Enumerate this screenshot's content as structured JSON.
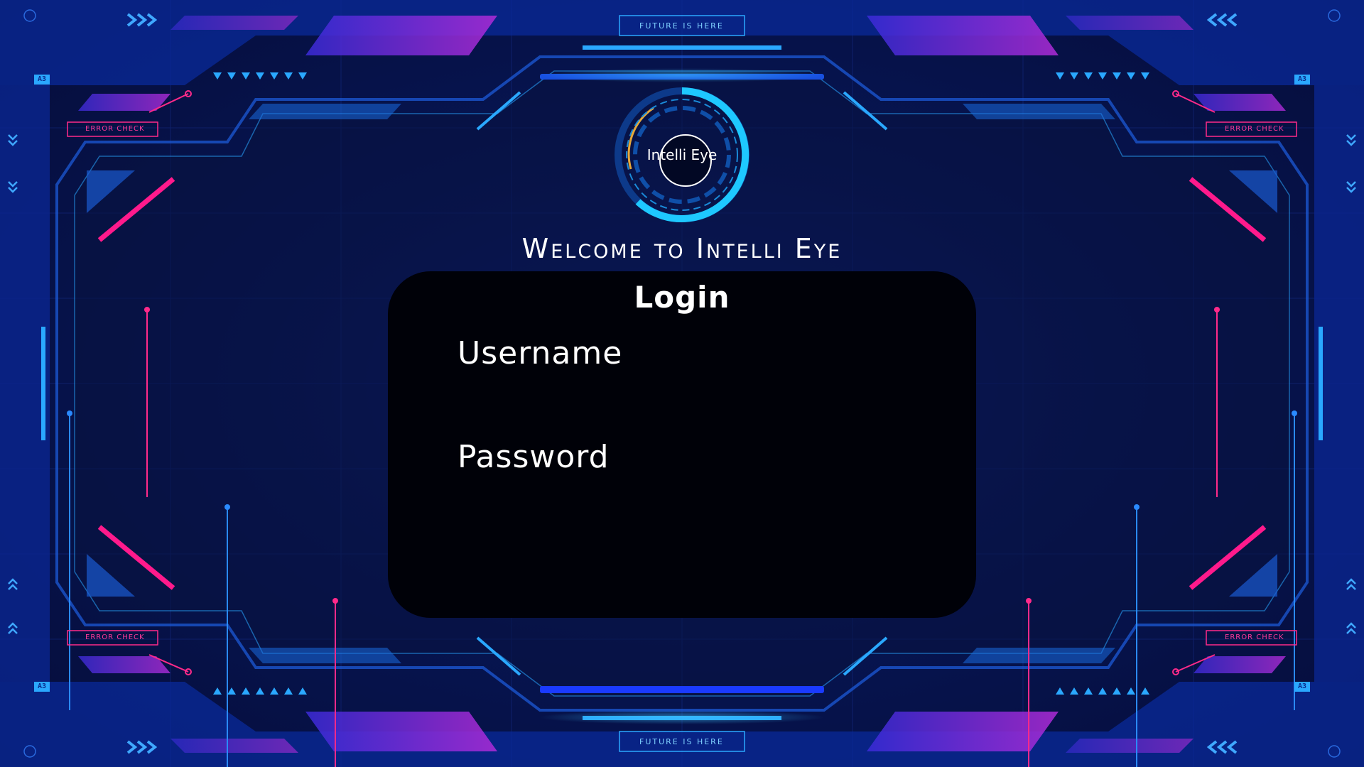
{
  "hud": {
    "top_banner": "FUTURE IS HERE",
    "bottom_banner": "FUTURE IS HERE",
    "error_check_label": "ERROR CHECK",
    "tag_a3": "A3"
  },
  "logo": {
    "text": "Intelli Eye"
  },
  "welcome": {
    "title": "Welcome to Intelli Eye"
  },
  "login": {
    "title": "Login",
    "username_label": "Username",
    "username_value": "",
    "password_label": "Password",
    "password_value": ""
  },
  "colors": {
    "background": "#071552",
    "panel": "#000108",
    "accent_cyan": "#2aa8ff",
    "accent_magenta": "#ff1a8c",
    "accent_purple": "#7a2bd8"
  }
}
